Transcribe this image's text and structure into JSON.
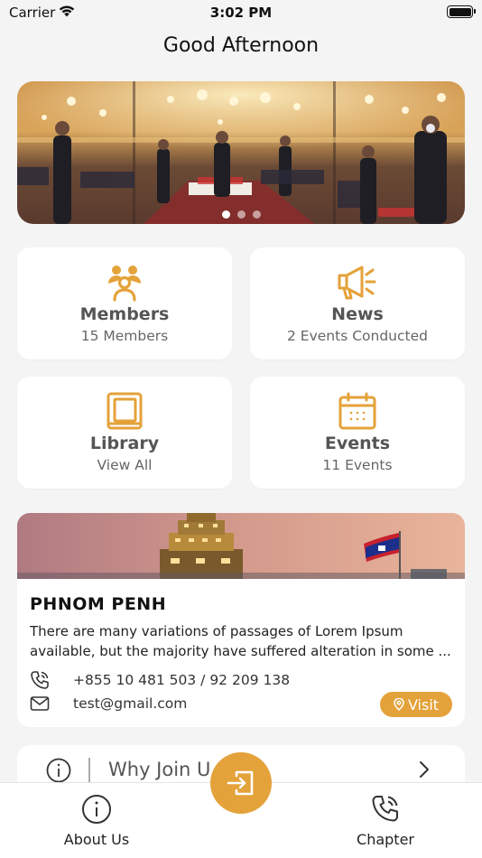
{
  "status_bar": {
    "carrier": "Carrier",
    "time": "3:02 PM"
  },
  "header": {
    "greeting": "Good Afternoon"
  },
  "banner": {
    "slide_count": 3,
    "active_slide": 1
  },
  "theme": {
    "accent": "#e4a23a",
    "background": "#f4f4f4",
    "card": "#ffffff"
  },
  "cards": [
    {
      "title": "Members",
      "subtitle": "15 Members",
      "icon": "members-icon"
    },
    {
      "title": "News",
      "subtitle": "2 Events Conducted",
      "icon": "megaphone-icon"
    },
    {
      "title": "Library",
      "subtitle": "View All",
      "icon": "book-icon"
    },
    {
      "title": "Events",
      "subtitle": "11 Events",
      "icon": "calendar-icon"
    }
  ],
  "location": {
    "title": "PHNOM PENH",
    "description_line1": "There are many variations of passages of Lorem Ipsum",
    "description_line2": "available, but the majority have suffered alteration in some ...",
    "phone": "+855 10 481 503 / 92 209 138",
    "email": "test@gmail.com",
    "visit_label": "Visit"
  },
  "why_join": {
    "label": "Why Join U"
  },
  "tab_bar": {
    "about_label": "About Us",
    "chapter_label": "Chapter"
  }
}
